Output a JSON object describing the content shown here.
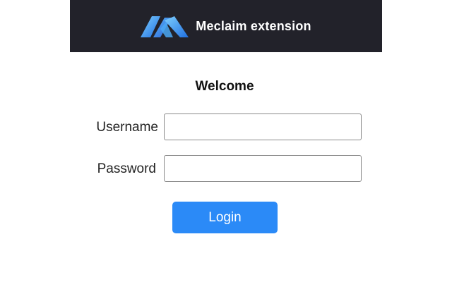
{
  "header": {
    "app_title": "Meclaim extension",
    "logo_icon": "meclaim-logo-icon",
    "background_color": "#22222a"
  },
  "form": {
    "heading": "Welcome",
    "username": {
      "label": "Username",
      "value": "",
      "placeholder": ""
    },
    "password": {
      "label": "Password",
      "value": "",
      "placeholder": ""
    },
    "login_label": "Login",
    "accent_color": "#2b8af7"
  }
}
